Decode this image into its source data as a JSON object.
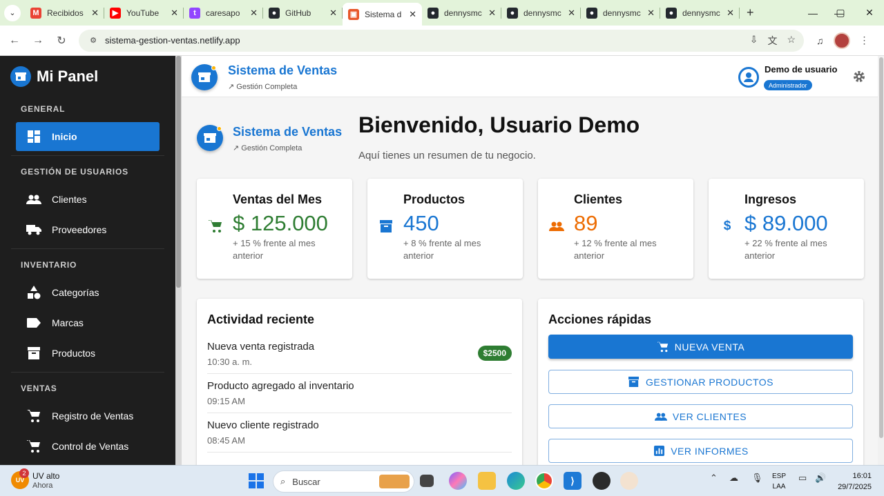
{
  "browser": {
    "tabs": [
      {
        "title": "Recibidos",
        "favicon": "gmail-icon",
        "color": "#ea4335",
        "glyph": "M"
      },
      {
        "title": "YouTube",
        "favicon": "youtube-icon",
        "color": "#ff0000",
        "glyph": "▶"
      },
      {
        "title": "caresapo",
        "favicon": "twitch-icon",
        "color": "#9146ff",
        "glyph": "t"
      },
      {
        "title": "GitHub",
        "favicon": "github-icon",
        "color": "#24292f",
        "glyph": "●"
      },
      {
        "title": "Sistema d",
        "favicon": "netlify-app-icon",
        "color": "#e8572a",
        "glyph": "▣",
        "active": true
      },
      {
        "title": "dennysmc",
        "favicon": "github-icon",
        "color": "#24292f",
        "glyph": "●"
      },
      {
        "title": "dennysmc",
        "favicon": "github-icon",
        "color": "#24292f",
        "glyph": "●"
      },
      {
        "title": "dennysmc",
        "favicon": "github-icon",
        "color": "#24292f",
        "glyph": "●"
      },
      {
        "title": "dennysmc",
        "favicon": "github-icon",
        "color": "#24292f",
        "glyph": "●"
      }
    ],
    "url": "sistema-gestion-ventas.netlify.app"
  },
  "sidebar": {
    "brand": "Mi Panel",
    "sections": {
      "general": "GENERAL",
      "usuarios": "GESTIÓN DE USUARIOS",
      "inventario": "INVENTARIO",
      "ventas": "VENTAS"
    },
    "items": {
      "inicio": "Inicio",
      "clientes": "Clientes",
      "proveedores": "Proveedores",
      "categorias": "Categorías",
      "marcas": "Marcas",
      "productos": "Productos",
      "registro": "Registro de Ventas",
      "control": "Control de Ventas"
    }
  },
  "header": {
    "title": "Sistema de Ventas",
    "subtitle": "Gestión Completa",
    "user_name": "Demo de usuario",
    "user_role": "Administrador"
  },
  "main": {
    "logo_title": "Sistema de Ventas",
    "logo_subtitle": "Gestión Completa",
    "welcome": "Bienvenido, Usuario Demo",
    "welcome_sub": "Aquí tienes un resumen de tu negocio."
  },
  "stats": [
    {
      "label": "Ventas del Mes",
      "value": "$ 125.000",
      "change": "+ 15 % frente al mes anterior",
      "color": "#2e7d32",
      "icon": "cart-icon"
    },
    {
      "label": "Productos",
      "value": "450",
      "change": "+ 8 % frente al mes anterior",
      "color": "#1976d2",
      "icon": "inventory-box-icon"
    },
    {
      "label": "Clientes",
      "value": "89",
      "change": "+ 12 % frente al mes anterior",
      "color": "#ed6c02",
      "icon": "people-icon"
    },
    {
      "label": "Ingresos",
      "value": "$ 89.000",
      "change": "+ 22 % frente al mes anterior",
      "color": "#1976d2",
      "icon": "dollar-icon"
    }
  ],
  "activity": {
    "title": "Actividad reciente",
    "items": [
      {
        "title": "Nueva venta registrada",
        "time": "10:30 a. m.",
        "badge": "$2500"
      },
      {
        "title": "Producto agregado al inventario",
        "time": "09:15 AM"
      },
      {
        "title": "Nuevo cliente registrado",
        "time": "08:45 AM"
      }
    ]
  },
  "quick": {
    "title": "Acciones rápidas",
    "buttons": {
      "nueva_venta": "NUEVA VENTA",
      "gestionar": "GESTIONAR PRODUCTOS",
      "clientes": "VER CLIENTES",
      "informes": "VER INFORMES"
    }
  },
  "taskbar": {
    "weather_title": "UV alto",
    "weather_sub": "Ahora",
    "weather_badge": "2",
    "search": "Buscar",
    "lang1": "ESP",
    "lang2": "LAA",
    "time": "16:01",
    "date": "29/7/2025"
  }
}
